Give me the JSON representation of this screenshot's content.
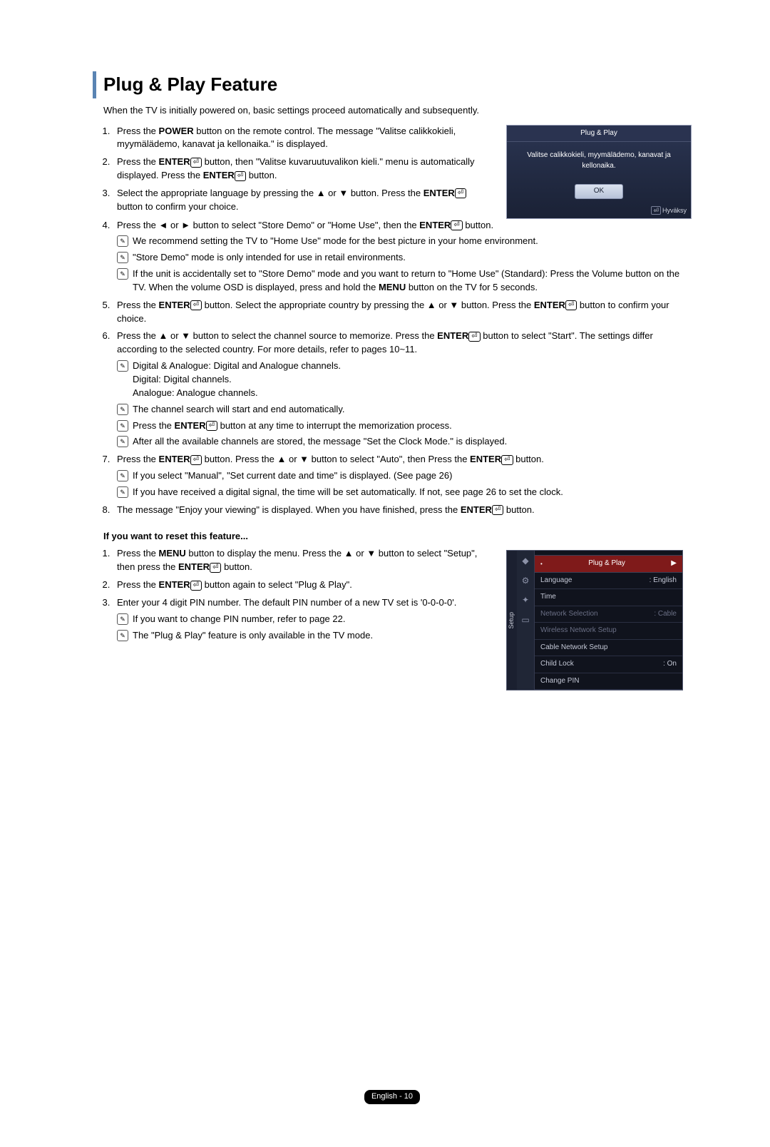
{
  "title": "Plug & Play Feature",
  "intro": "When the TV is initially powered on, basic settings proceed automatically and subsequently.",
  "steps_a": [
    {
      "pre": "Press the ",
      "bold": "POWER",
      "post": " button on the remote control. The message \"Valitse calikkokieli, myymälädemo, kanavat ja kellonaika.\" is displayed."
    },
    {
      "pre": "Press the ",
      "bold": "ENTER",
      "icon": true,
      "post": " button, then \"Valitse kuvaruutuvalikon kieli.\" menu is automatically displayed. Press the ",
      "bold2": "ENTER",
      "icon2": true,
      "post2": " button."
    },
    {
      "pre": "Select the appropriate language by pressing the ▲ or ▼ button. Press the ",
      "bold": "ENTER",
      "icon": true,
      "post": " button to confirm your choice."
    }
  ],
  "step4": {
    "text_a": "Press the ◄ or ► button to select \"Store Demo\" or \"Home Use\", then the ",
    "bold": "ENTER",
    "icon": true,
    "text_b": " button.",
    "notes": [
      "We recommend setting the TV to \"Home Use\" mode for the best picture in your home environment.",
      "\"Store Demo\" mode is only intended for use in retail environments.",
      "If the unit is accidentally set to \"Store Demo\" mode and you want to return to \"Home Use\" (Standard): Press the Volume button on the TV. When the volume OSD is displayed, press and hold the MENU button on the TV for 5 seconds."
    ]
  },
  "step5": "Press the ENTER button. Select the appropriate country by pressing the ▲ or ▼ button. Press the ENTER button to confirm your choice.",
  "step6": {
    "text": "Press the ▲ or ▼ button to select the channel source to memorize. Press the ENTER button to select \"Start\". The settings differ according to the selected country. For more details, refer to pages 10~11.",
    "notes": [
      "Digital & Analogue: Digital and Analogue channels.\nDigital: Digital channels.\nAnalogue: Analogue channels.",
      "The channel search will start and end automatically.",
      "Press the ENTER button at any time to interrupt the memorization process.",
      "After all the available channels are stored, the message \"Set the Clock Mode.\" is displayed."
    ]
  },
  "step7": {
    "text": "Press the ENTER button. Press the ▲ or ▼ button to select \"Auto\", then Press the ENTER button.",
    "notes": [
      "If you select \"Manual\", \"Set current date and time\" is displayed. (See page 26)",
      "If you have received a digital signal, the time will be set automatically. If not, see page 26 to set the clock."
    ]
  },
  "step8": "The message \"Enjoy your viewing\" is displayed. When you have finished, press the ENTER button.",
  "reset_head": "If you want to reset this feature...",
  "reset_steps": [
    "Press the MENU button to display the menu. Press the ▲ or ▼ button to select \"Setup\", then press the ENTER button.",
    "Press the ENTER button again to select \"Plug & Play\".",
    "Enter your 4 digit PIN number. The default PIN number of a new TV set is '0-0-0-0'."
  ],
  "reset_notes": [
    "If you want to change PIN number, refer to page 22.",
    "The \"Plug & Play\" feature is only available in the TV mode."
  ],
  "osd": {
    "title": "Plug & Play",
    "message": "Valitse calikkokieli, myymälädemo, kanavat ja kellonaika.",
    "ok": "OK",
    "accept": "Hyväksy"
  },
  "menu": {
    "side": "Setup",
    "highlight": "Plug & Play",
    "items": [
      {
        "label": "Language",
        "value": ": English",
        "dim": false
      },
      {
        "label": "Time",
        "value": "",
        "dim": false
      },
      {
        "label": "Network Selection",
        "value": ": Cable",
        "dim": true
      },
      {
        "label": "Wireless Network Setup",
        "value": "",
        "dim": true
      },
      {
        "label": "Cable Network Setup",
        "value": "",
        "dim": false
      },
      {
        "label": "Child Lock",
        "value": ": On",
        "dim": false
      },
      {
        "label": "Change PIN",
        "value": "",
        "dim": false
      }
    ]
  },
  "footer": "English - 10"
}
